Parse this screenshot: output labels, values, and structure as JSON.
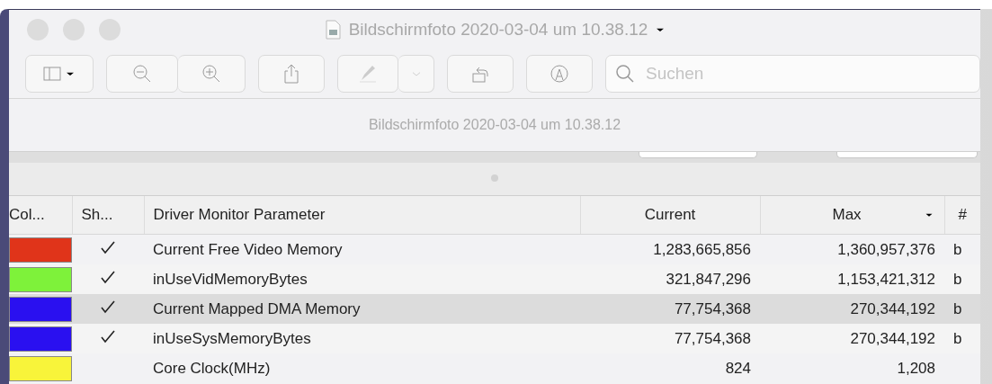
{
  "window": {
    "title": "Bildschirmfoto 2020-03-04 um 10.38.12"
  },
  "search": {
    "placeholder": "Suchen"
  },
  "document": {
    "title": "Bildschirmfoto 2020-03-04 um 10.38.12"
  },
  "table": {
    "columns": [
      {
        "label": "Col..."
      },
      {
        "label": "Sh..."
      },
      {
        "label": "Driver Monitor Parameter"
      },
      {
        "label": "Current"
      },
      {
        "label": "Max",
        "sorted": true
      },
      {
        "label": "#"
      }
    ],
    "rows": [
      {
        "color": "#e0341a",
        "shown": true,
        "parameter": "Current Free Video Memory",
        "current": "1,283,665,856",
        "max": "1,360,957,376",
        "unit": "b",
        "selected": false
      },
      {
        "color": "#7ef23a",
        "shown": true,
        "parameter": "inUseVidMemoryBytes",
        "current": "321,847,296",
        "max": "1,153,421,312",
        "unit": "b",
        "selected": false
      },
      {
        "color": "#2a10f0",
        "shown": true,
        "parameter": "Current Mapped DMA Memory",
        "current": "77,754,368",
        "max": "270,344,192",
        "unit": "b",
        "selected": true
      },
      {
        "color": "#2a10f0",
        "shown": true,
        "parameter": "inUseSysMemoryBytes",
        "current": "77,754,368",
        "max": "270,344,192",
        "unit": "b",
        "selected": false
      },
      {
        "color": "#f8f43a",
        "shown": false,
        "parameter": "Core Clock(MHz)",
        "current": "824",
        "max": "1,208",
        "selected": false
      }
    ]
  }
}
